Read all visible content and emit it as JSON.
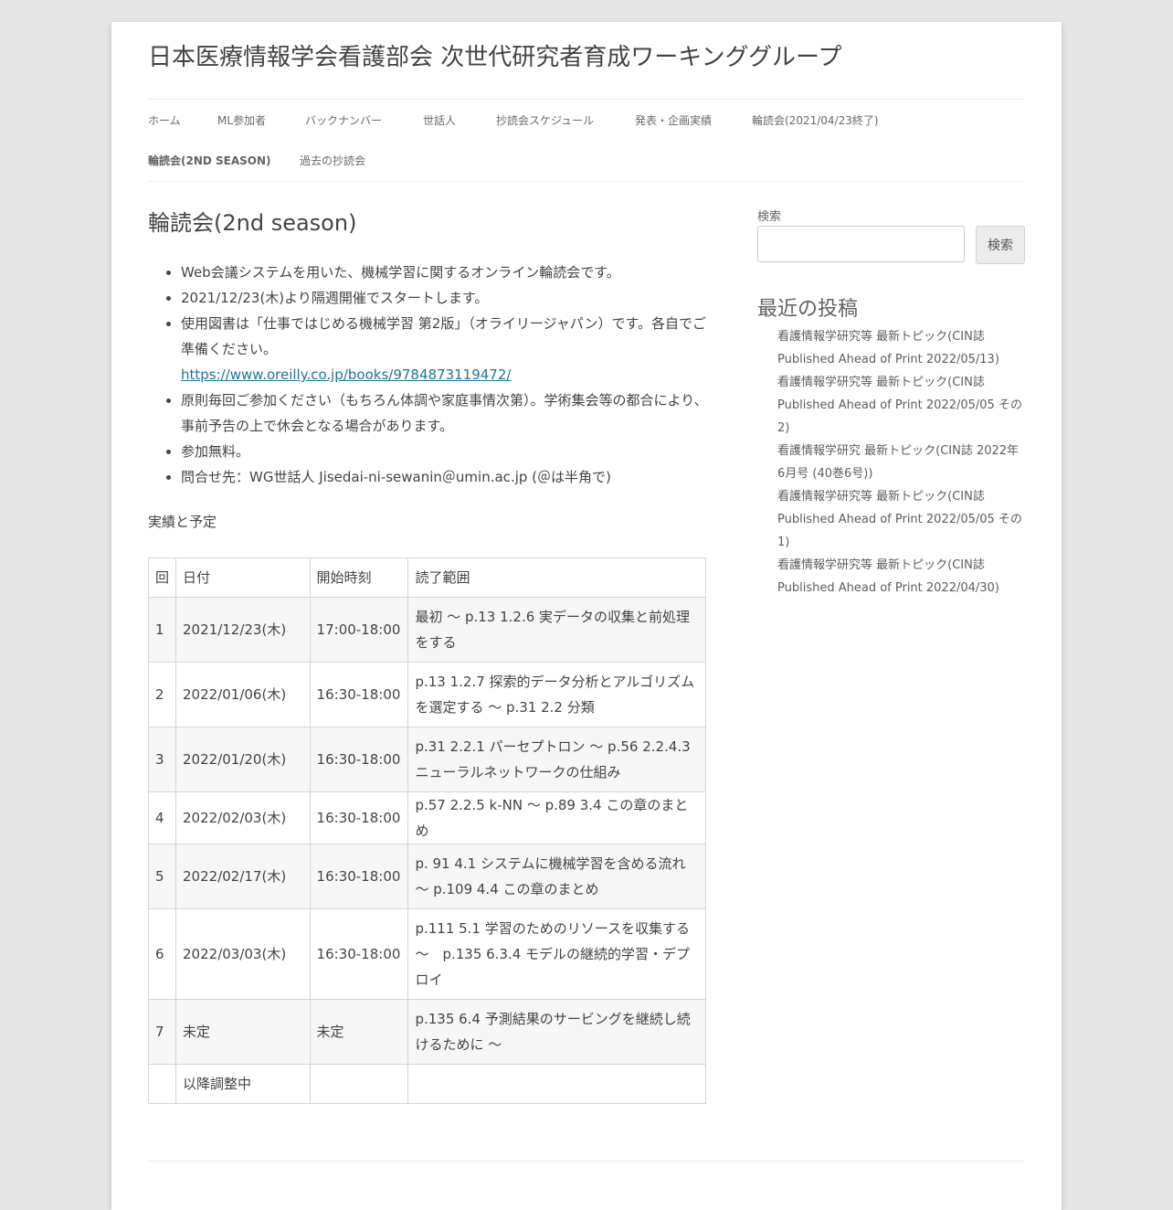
{
  "site": {
    "title": "日本医療情報学会看護部会 次世代研究者育成ワーキンググループ"
  },
  "nav": {
    "items": [
      {
        "label": "ホーム"
      },
      {
        "label": "ML参加者"
      },
      {
        "label": "バックナンバー"
      },
      {
        "label": "世話人"
      },
      {
        "label": "抄読会スケジュール"
      },
      {
        "label": "発表・企画実績"
      },
      {
        "label": "輪読会(2021/04/23終了)"
      },
      {
        "label": "輪読会(2ND SEASON)"
      },
      {
        "label": "過去の抄読会"
      }
    ]
  },
  "entry": {
    "title": "輪読会(2nd season)",
    "bullets": [
      "Web会議システムを用いた、機械学習に関するオンライン輪読会です。",
      "2021/12/23(木)より隔週開催でスタートします。",
      "使用図書は「仕事ではじめる機械学習 第2版」（オライリージャパン）です。各自でご準備ください。",
      "原則毎回ご参加ください（もちろん体調や家庭事情次第）。学術集会等の都合により、事前予告の上で休会となる場合があります。",
      "参加無料。",
      "問合せ先：WG世話人 Jisedai-ni-sewanin＠umin.ac.jp (＠は半角で)"
    ],
    "book_link": "https://www.oreilly.co.jp/books/9784873119472/",
    "schedule_label": "実績と予定",
    "table": {
      "headers": [
        "回",
        "日付",
        "開始時刻",
        "読了範囲"
      ],
      "rows": [
        {
          "no": "1",
          "date": "2021/12/23(木)",
          "time": "17:00-18:00",
          "range": "最初 ～ p.13 1.2.6 実データの収集と前処理をする"
        },
        {
          "no": "2",
          "date": "2022/01/06(木)",
          "time": "16:30-18:00",
          "range": "p.13 1.2.7 探索的データ分析とアルゴリズムを選定する ～ p.31 2.2 分類"
        },
        {
          "no": "3",
          "date": "2022/01/20(木)",
          "time": "16:30-18:00",
          "range": "p.31 2.2.1 パーセプトロン ～ p.56 2.2.4.3 ニューラルネットワークの仕組み"
        },
        {
          "no": "4",
          "date": "2022/02/03(木)",
          "time": "16:30-18:00",
          "range": "p.57 2.2.5 k-NN ～ p.89 3.4 この章のまとめ"
        },
        {
          "no": "5",
          "date": "2022/02/17(木)",
          "time": "16:30-18:00",
          "range": "p. 91 4.1 システムに機械学習を含める流れ ～ p.109 4.4 この章のまとめ"
        },
        {
          "no": "6",
          "date": "2022/03/03(木)",
          "time": "16:30-18:00",
          "range": "p.111 5.1 学習のためのリソースを収集する ～　p.135 6.3.4 モデルの継続的学習・デプロイ"
        },
        {
          "no": "7",
          "date": "未定",
          "time": "未定",
          "range": "p.135 6.4 予測結果のサービングを継続し続けるために ～"
        },
        {
          "no": "",
          "date": "以降調整中",
          "time": "",
          "range": ""
        }
      ]
    }
  },
  "sidebar": {
    "search_label": "検索",
    "search_placeholder": "",
    "search_button": "検索",
    "recent_title": "最近の投稿",
    "recent_posts": [
      "看護情報学研究等 最新トピック(CIN誌 Published Ahead of Print 2022/05/13)",
      "看護情報学研究等 最新トピック(CIN誌 Published Ahead of Print 2022/05/05 その2)",
      "看護情報学研究 最新トピック(CIN誌 2022年6月号 (40巻6号))",
      "看護情報学研究等 最新トピック(CIN誌 Published Ahead of Print 2022/05/05 その1)",
      "看護情報学研究等 最新トピック(CIN誌 Published Ahead of Print 2022/04/30)"
    ]
  },
  "colors": {
    "background": "#e6e6e6",
    "page": "#ffffff",
    "text": "#444444",
    "link": "#21759b",
    "table_row_alt": "#f6f6f6",
    "border": "#d6d6d6"
  }
}
